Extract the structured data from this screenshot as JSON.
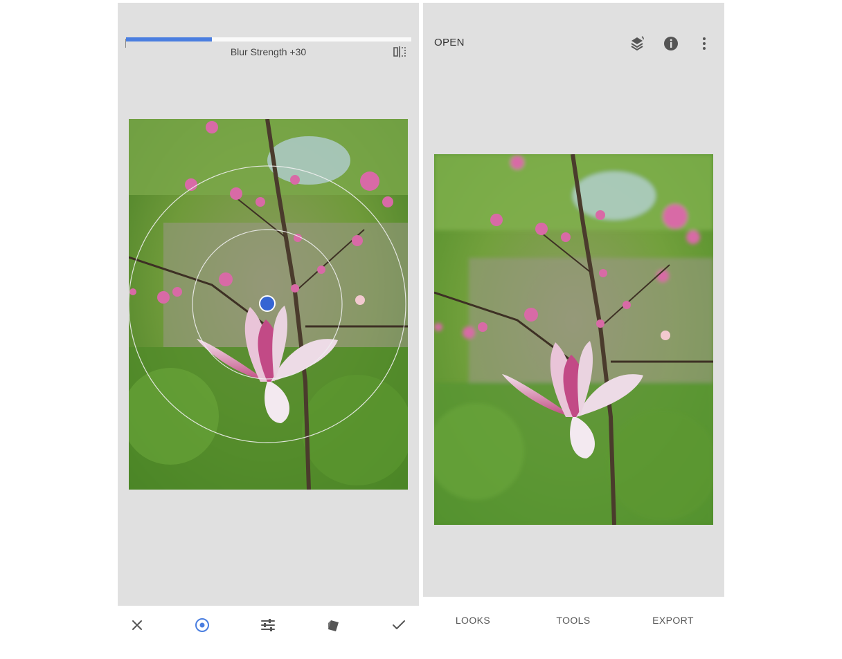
{
  "left": {
    "slider": {
      "label": "Blur Strength +30",
      "value": 30,
      "fill_fraction": 0.3
    },
    "toolbar": {
      "items": [
        {
          "icon": "close-icon"
        },
        {
          "icon": "target-icon",
          "active": true
        },
        {
          "icon": "sliders-icon"
        },
        {
          "icon": "styles-icon"
        },
        {
          "icon": "check-icon"
        }
      ]
    },
    "compare_icon": "compare-icon"
  },
  "right": {
    "topbar": {
      "open_label": "OPEN",
      "icons": [
        "layers-history-icon",
        "info-icon",
        "more-vert-icon"
      ]
    },
    "bottom_nav": {
      "looks": "LOOKS",
      "tools": "TOOLS",
      "export": "EXPORT"
    }
  },
  "colors": {
    "accent": "#4a7ee0",
    "panel_bg": "#e0e0e0",
    "icon": "#555555"
  }
}
